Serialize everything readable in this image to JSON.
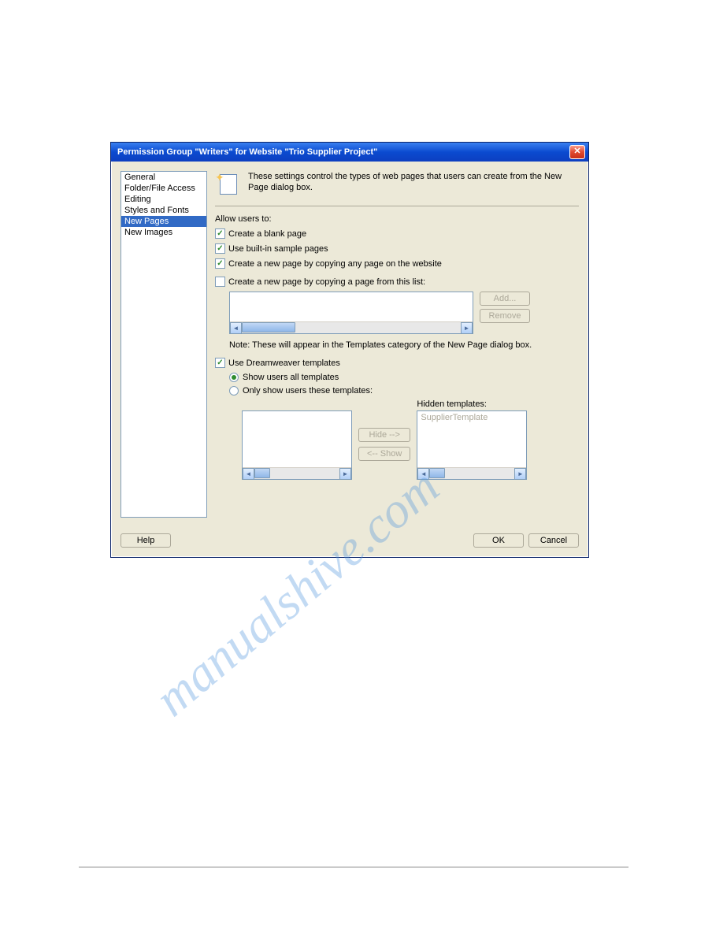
{
  "titlebar": {
    "text": "Permission Group \"Writers\" for Website \"Trio Supplier Project\""
  },
  "sidebar": {
    "items": [
      {
        "label": "General"
      },
      {
        "label": "Folder/File Access"
      },
      {
        "label": "Editing"
      },
      {
        "label": "Styles and Fonts"
      },
      {
        "label": "New Pages",
        "selected": true
      },
      {
        "label": "New Images"
      }
    ]
  },
  "main": {
    "description": "These settings control the types of web pages that users can create from the New Page dialog box.",
    "allow_label": "Allow users to:",
    "checks": {
      "blank": {
        "label": "Create a blank page",
        "checked": true
      },
      "sample": {
        "label": "Use built-in sample pages",
        "checked": true
      },
      "copy_any": {
        "label": "Create a new page by copying any page on the website",
        "checked": true
      },
      "copy_list": {
        "label": "Create a new page by copying a page from this list:",
        "checked": false
      }
    },
    "buttons": {
      "add": "Add...",
      "remove": "Remove",
      "hide": "Hide -->",
      "show": "<-- Show"
    },
    "note": "Note: These will appear in the Templates category of the New Page dialog box.",
    "dw_templates": {
      "label": "Use Dreamweaver templates",
      "checked": true,
      "radio_all": "Show users all templates",
      "radio_only": "Only show users these templates:",
      "selected": "all",
      "hidden_label": "Hidden templates:",
      "hidden_items": [
        "SupplierTemplate"
      ]
    }
  },
  "footer": {
    "help": "Help",
    "ok": "OK",
    "cancel": "Cancel"
  },
  "watermark": "manualshive.com"
}
